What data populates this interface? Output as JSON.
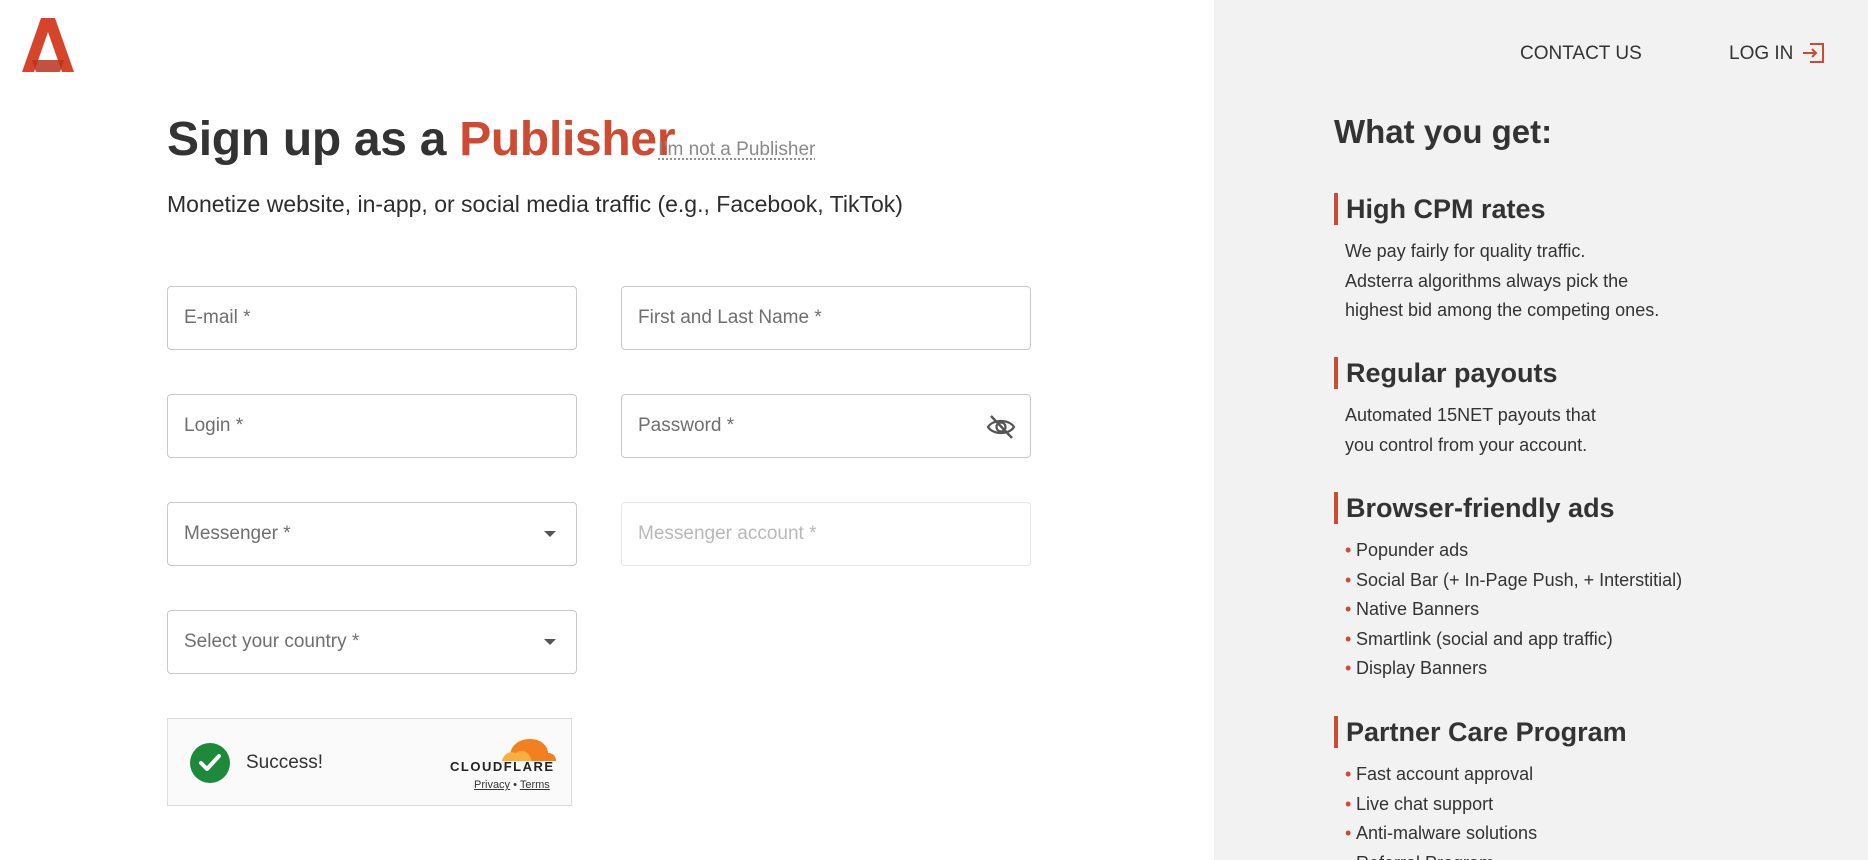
{
  "brand": {
    "accent_color": "#cc4b32",
    "logo_icon": "adsterra-logo-icon"
  },
  "header": {
    "title_prefix": "Sign up as a",
    "title_highlight": "Publisher",
    "not_publisher_link": "I’m not a Publisher",
    "subtitle": "Monetize website, in-app, or social media traffic (e.g., Facebook, TikTok)"
  },
  "form": {
    "email": {
      "placeholder": "E-mail *"
    },
    "name": {
      "placeholder": "First and Last Name *"
    },
    "login": {
      "placeholder": "Login *"
    },
    "password": {
      "placeholder": "Password *",
      "toggle_icon": "eye-off-icon"
    },
    "messenger": {
      "placeholder": "Messenger *"
    },
    "messenger_account": {
      "placeholder": "Messenger account *"
    },
    "country": {
      "placeholder": "Select your country *"
    }
  },
  "captcha": {
    "status": "Success!",
    "provider": "CLOUDFLARE",
    "privacy": "Privacy",
    "separator": "•",
    "terms": "Terms"
  },
  "nav": {
    "contact": "CONTACT US",
    "login": "LOG IN",
    "login_icon": "sign-in-icon"
  },
  "sidebar": {
    "heading": "What you get:",
    "sections": [
      {
        "title": "High CPM rates",
        "lines": [
          "We pay fairly for quality traffic.",
          "Adsterra algorithms always pick the",
          "highest bid among the competing ones."
        ]
      },
      {
        "title": "Regular payouts",
        "lines": [
          "Automated 15NET payouts that",
          "you control from your account."
        ]
      },
      {
        "title": "Browser-friendly ads",
        "bullets": [
          "Popunder ads",
          "Social Bar (+ In-Page Push, + Interstitial)",
          "Native Banners",
          "Smartlink (social and app traffic)",
          "Display Banners"
        ]
      },
      {
        "title": "Partner Care Program",
        "bullets": [
          "Fast account approval",
          "Live chat support",
          "Anti-malware solutions",
          "Referral Program"
        ]
      }
    ]
  }
}
